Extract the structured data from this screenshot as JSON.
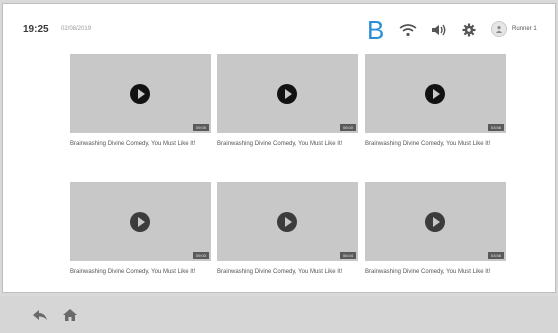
{
  "status_bar": {
    "time": "19:25",
    "date": "02/08/2019",
    "marker": "B",
    "user_name": "Runner 1",
    "icons": [
      "wifi-icon",
      "volume-icon",
      "gear-icon",
      "user-icon"
    ]
  },
  "videos": [
    {
      "title": "Brainwashing Divine Comedy, You Must Like It!",
      "duration": "09:05"
    },
    {
      "title": "Brainwashing Divine Comedy, You Must Like It!",
      "duration": "06:00"
    },
    {
      "title": "Brainwashing Divine Comedy, You Must Like It!",
      "duration": "03:56"
    },
    {
      "title": "Brainwashing Divine Comedy, You Must Like It!",
      "duration": "09:03"
    },
    {
      "title": "Brainwashing Divine Comedy, You Must Like It!",
      "duration": "06:04"
    },
    {
      "title": "Brainwashing Divine Comedy, You Must Like It!",
      "duration": "03:56"
    }
  ],
  "nav": {
    "icons": [
      "back-icon",
      "home-icon"
    ]
  },
  "colors": {
    "marker": "#2a8fd8",
    "thumbnail": "#c8c8c8",
    "background": "#ffffff"
  }
}
